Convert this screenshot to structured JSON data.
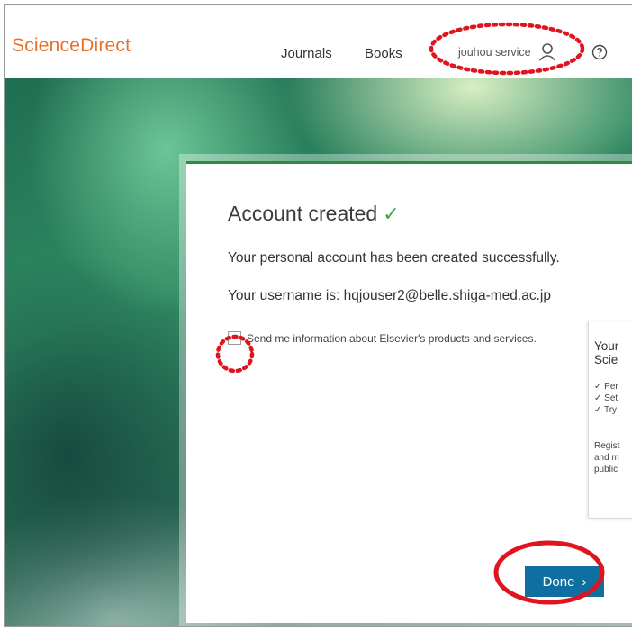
{
  "header": {
    "logo": "ScienceDirect",
    "nav": {
      "journals": "Journals",
      "books": "Books"
    },
    "user_name": "jouhou service",
    "user_icon": "person-icon",
    "help_icon": "help-circle-icon"
  },
  "dialog": {
    "title": "Account created",
    "title_check": "✓",
    "message": "Your personal account has been created successfully.",
    "username_line": "Your username is: hqjouser2@belle.shiga-med.ac.jp",
    "opt_in_label": "Send me information about Elsevier's products and services.",
    "opt_in_checked": false,
    "done_label": "Done",
    "done_chevron": "›"
  },
  "side_panel": {
    "title_line1": "Your",
    "title_line2": "Scie",
    "bullets": [
      "✓ Per",
      "✓ Set",
      "✓ Try"
    ],
    "text_lines": [
      "Regist",
      "and m",
      "public"
    ]
  },
  "colors": {
    "logo": "#e8702a",
    "accent_green": "#2e8b43",
    "done_button": "#0f6fa0",
    "highlight_red": "#e0141e"
  }
}
